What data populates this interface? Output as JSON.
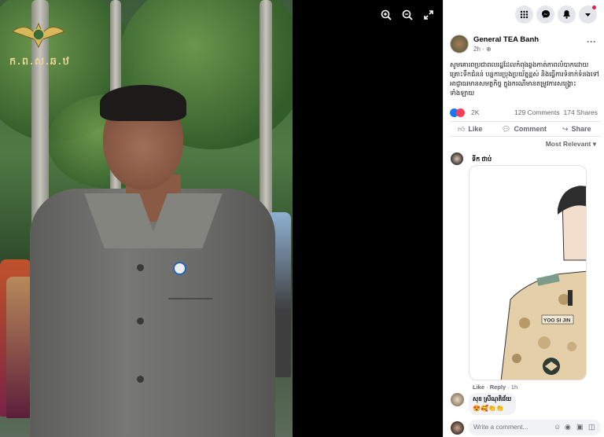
{
  "viewer": {
    "watermark_text": "ក.ព.ស.ឆ.ឋ",
    "toolbar": {
      "zoom_in_icon": "zoom-in-icon",
      "zoom_out_icon": "zoom-out-icon",
      "fullscreen_icon": "fullscreen-icon"
    }
  },
  "topbar": {
    "menu_icon": "grid-icon",
    "messenger_icon": "messenger-icon",
    "notifications_icon": "bell-icon",
    "account_icon": "caret-down-icon"
  },
  "post": {
    "page_name": "General TEA Banh",
    "time": "2h",
    "more_label": "···",
    "text": "សូមគោរពប្រជាពលរដ្ឋដែលកំពុងឆ្លងកាត់ភាពលំបាកដោយគ្រោះទឹកជំនន់ បន្តការប្រុងប្រយ័ត្នខ្ពស់ និងធ្វើការទំនាក់ទំនងទៅអាជ្ញាធរមានសមត្ថកិច្ច ក្នុងករណីមានតម្រូវការសង្គ្រោះទាំងឡាយ",
    "reaction_count": "2K",
    "comments_count": "129 Comments",
    "shares_count": "174 Shares",
    "actions": {
      "like": "Like",
      "comment": "Comment",
      "share": "Share"
    },
    "sort_label": "Most Relevant"
  },
  "comments": [
    {
      "name": "ទីក ថាប់",
      "actions": {
        "like": "Like",
        "reply": "Reply",
        "time": "1h"
      },
      "image_text": "YOO SI JIN"
    },
    {
      "name": "សុខ ស្រីណុតិជ័យ",
      "emoji": "😍🥰👏👏"
    }
  ],
  "composer": {
    "placeholder": "Write a comment..."
  },
  "colors": {
    "accent": "#1877f2",
    "like_blue": "#1877f2",
    "love_red": "#f33e58",
    "text_gray": "#65676b"
  }
}
